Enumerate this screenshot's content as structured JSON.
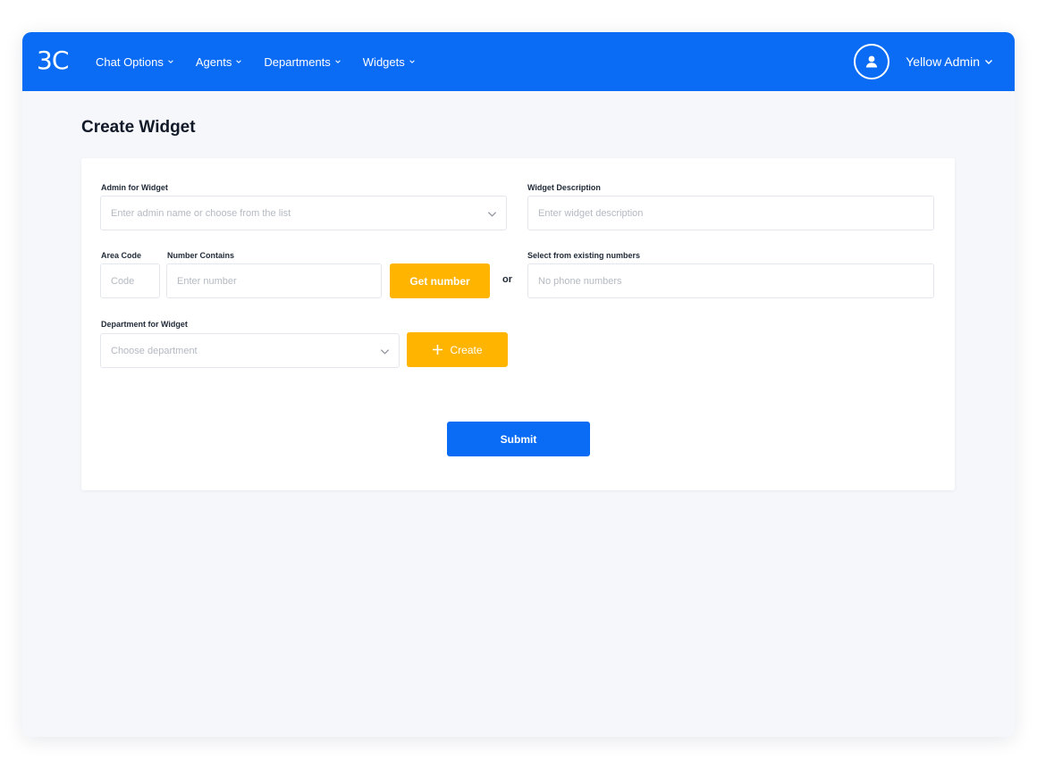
{
  "app": {
    "logo_text": "3C",
    "nav": [
      {
        "label": "Chat Options",
        "icon": "chevron-down-icon"
      },
      {
        "label": "Agents",
        "icon": "chevron-down-icon"
      },
      {
        "label": "Departments",
        "icon": "chevron-down-icon"
      },
      {
        "label": "Widgets",
        "icon": "chevron-down-icon"
      }
    ],
    "user": {
      "name": "Yellow Admin",
      "icon": "user-avatar-icon"
    }
  },
  "page": {
    "title": "Create Widget"
  },
  "form": {
    "admin": {
      "label": "Admin for Widget",
      "placeholder": "Enter admin name or choose from the list"
    },
    "description": {
      "label": "Widget Description",
      "placeholder": "Enter widget description"
    },
    "area_code": {
      "label": "Area Code",
      "placeholder": "Code"
    },
    "number_contains": {
      "label": "Number Contains",
      "placeholder": "Enter number"
    },
    "get_number_label": "Get number",
    "or_text": "or",
    "existing_numbers": {
      "label": "Select from existing numbers",
      "placeholder": "No phone numbers"
    },
    "department": {
      "label": "Department for Widget",
      "placeholder": "Choose department"
    },
    "create_label": "Create",
    "submit_label": "Submit"
  },
  "colors": {
    "primary": "#0a6cf5",
    "accent": "#ffb400",
    "background": "#f5f7fb"
  }
}
